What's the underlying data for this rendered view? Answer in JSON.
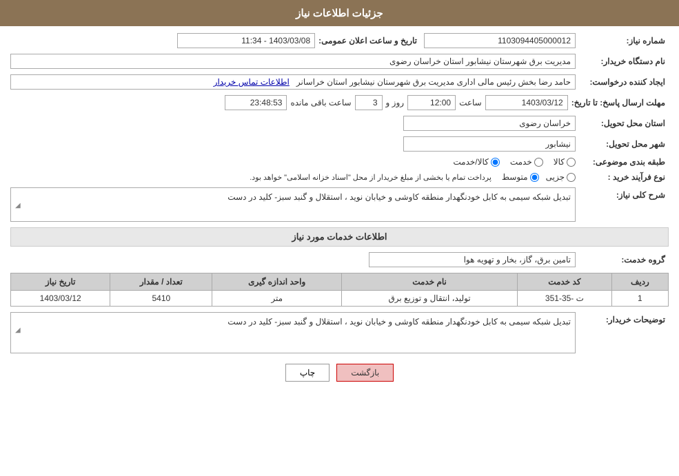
{
  "header": {
    "title": "جزئیات اطلاعات نیاز"
  },
  "fields": {
    "need_number_label": "شماره نیاز:",
    "need_number_value": "1103094405000012",
    "buyer_org_label": "نام دستگاه خریدار:",
    "buyer_org_value": "مدیریت برق شهرستان نیشابور استان خراسان رضوی",
    "creator_label": "ایجاد کننده درخواست:",
    "creator_value": "حامد رضا بخش رئیس مالی اداری مدیریت برق شهرستان نیشابور استان خراسانر",
    "creator_link": "اطلاعات تماس خریدار",
    "announcement_label": "تاریخ و ساعت اعلان عمومی:",
    "announcement_value": "1403/03/08 - 11:34",
    "reply_deadline_label": "مهلت ارسال پاسخ: تا تاریخ:",
    "reply_date_value": "1403/03/12",
    "reply_time_label": "ساعت",
    "reply_time_value": "12:00",
    "reply_days_label": "روز و",
    "reply_days_value": "3",
    "remaining_label": "ساعت باقی مانده",
    "remaining_value": "23:48:53",
    "province_label": "استان محل تحویل:",
    "province_value": "خراسان رضوی",
    "city_label": "شهر محل تحویل:",
    "city_value": "نیشابور",
    "category_label": "طبقه بندی موضوعی:",
    "category_options": [
      {
        "label": "کالا",
        "checked": false
      },
      {
        "label": "خدمت",
        "checked": false
      },
      {
        "label": "کالا/خدمت",
        "checked": true
      }
    ],
    "process_label": "نوع فرآیند خرید :",
    "process_options": [
      {
        "label": "جزیی",
        "checked": false
      },
      {
        "label": "متوسط",
        "checked": true
      }
    ],
    "process_note": "پرداخت تمام یا بخشی از مبلغ خریدار از محل \"اسناد خزانه اسلامی\" خواهد بود.",
    "need_desc_label": "شرح کلی نیاز:",
    "need_desc_value": "تبدیل شبکه سیمی به کابل خودنگهدار منطقه کاوشی و خیابان نوید ، استقلال و گنبد سبز- کلید در دست",
    "services_title": "اطلاعات خدمات مورد نیاز",
    "service_group_label": "گروه خدمت:",
    "service_group_value": "تامین برق، گاز، بخار و تهویه هوا",
    "table": {
      "columns": [
        "ردیف",
        "کد خدمت",
        "نام خدمت",
        "واحد اندازه گیری",
        "تعداد / مقدار",
        "تاریخ نیاز"
      ],
      "rows": [
        {
          "row_num": "1",
          "code": "ت -35-351",
          "name": "تولید، انتقال و توزیع برق",
          "unit": "متر",
          "count": "5410",
          "date": "1403/03/12"
        }
      ]
    },
    "buyer_desc_label": "توضیحات خریدار:",
    "buyer_desc_value": "تبدیل شبکه سیمی به کابل خودنگهدار منطقه کاوشی و خیابان نوید ، استقلال و گنبد سبز- کلید در دست"
  },
  "buttons": {
    "print_label": "چاپ",
    "back_label": "بازگشت"
  }
}
